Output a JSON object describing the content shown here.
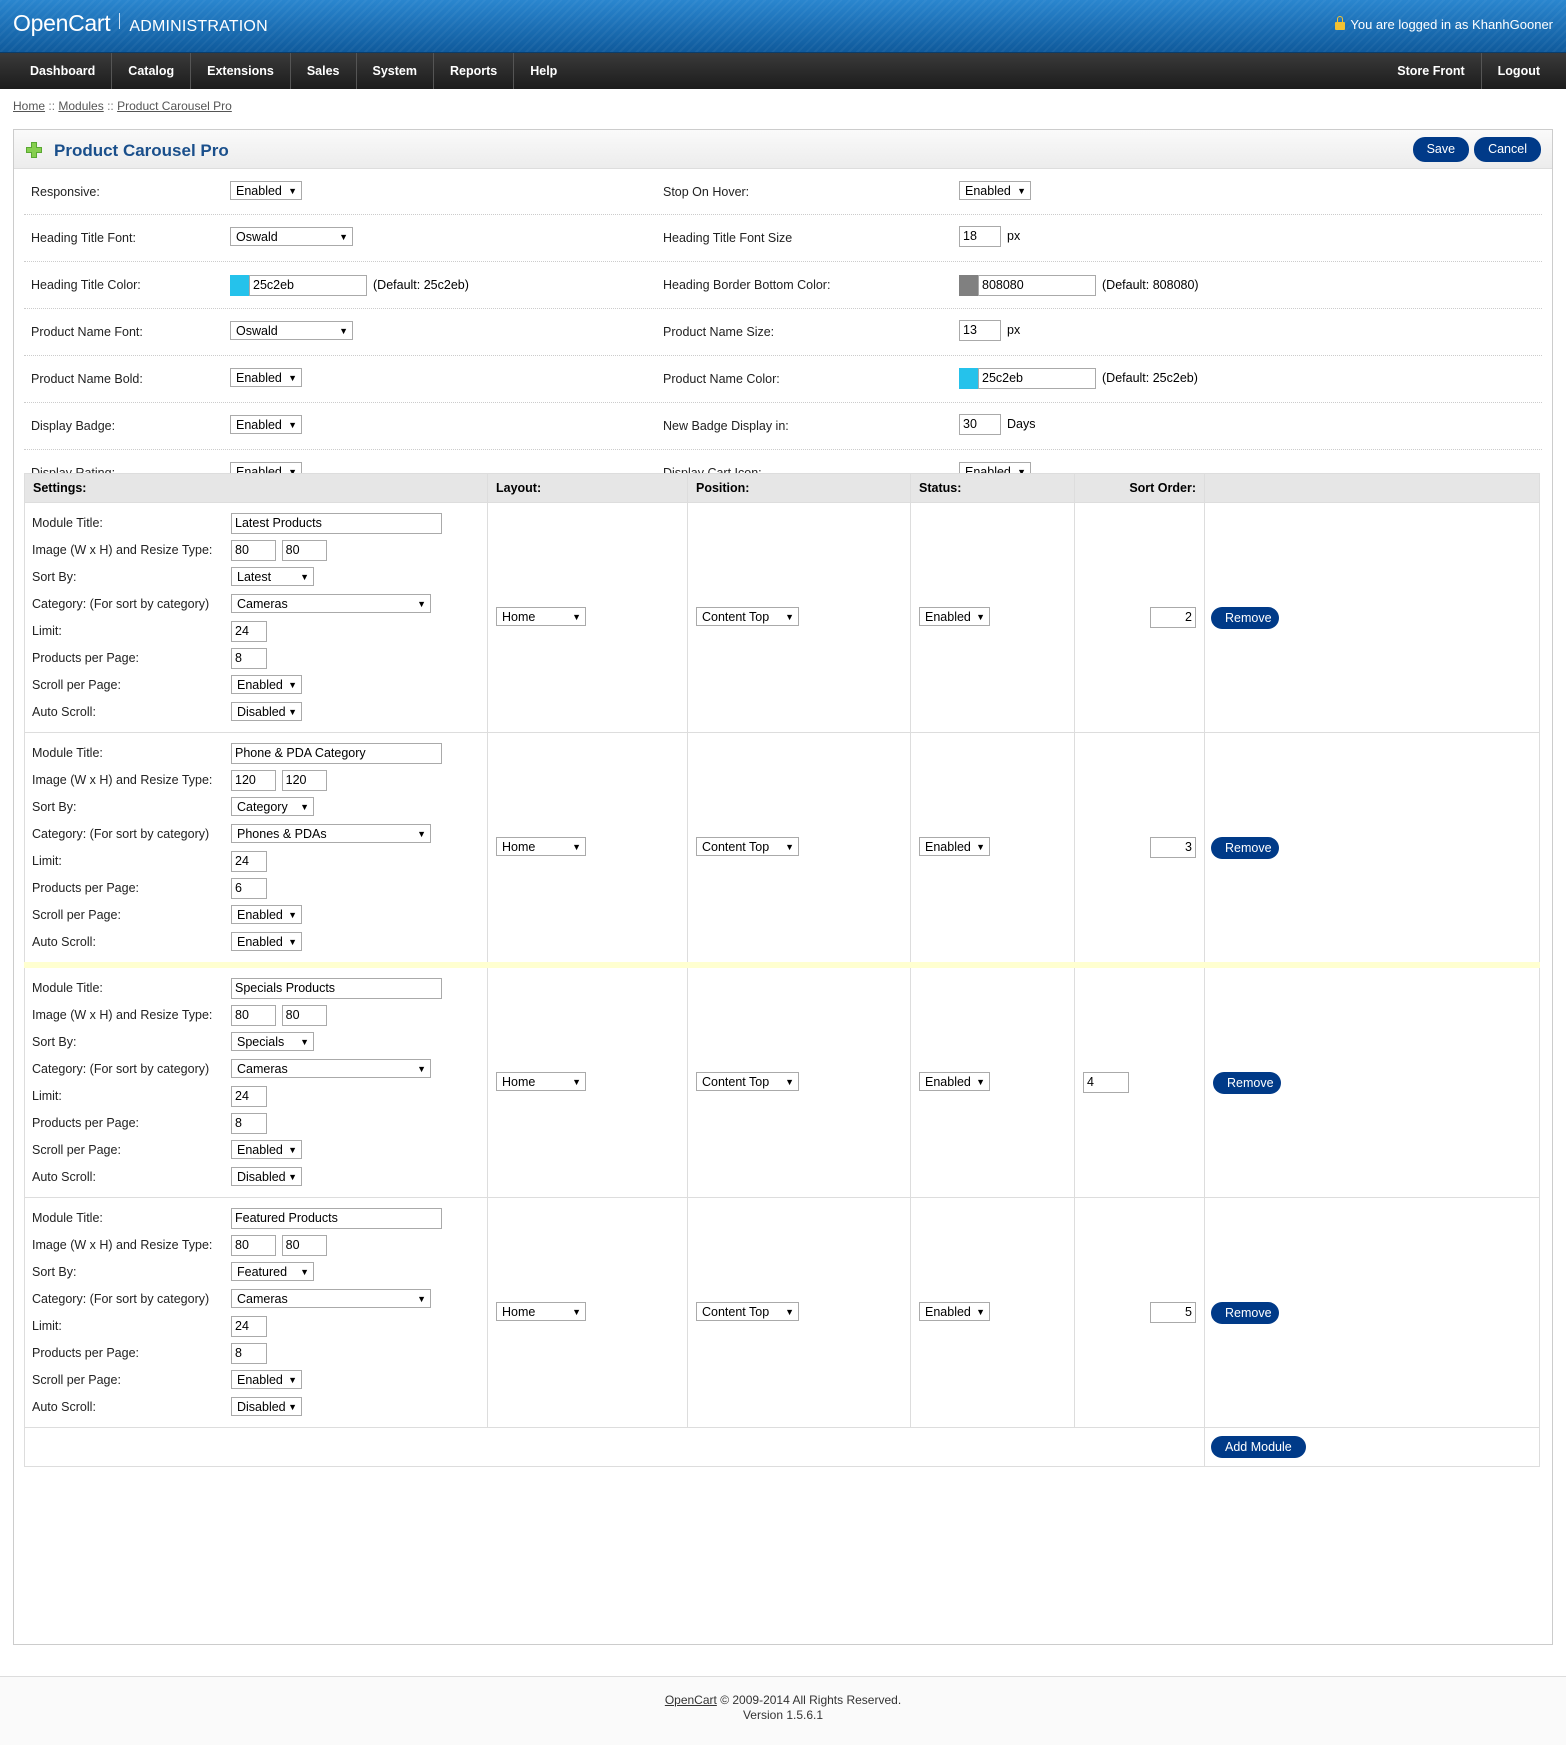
{
  "header": {
    "logo": "OpenCart",
    "subtitle": "ADMINISTRATION",
    "logged_in": "You are logged in as KhanhGooner"
  },
  "menu": {
    "left": [
      "Dashboard",
      "Catalog",
      "Extensions",
      "Sales",
      "System",
      "Reports",
      "Help"
    ],
    "right": [
      "Store Front",
      "Logout"
    ]
  },
  "breadcrumb": {
    "home": "Home",
    "modules": "Modules",
    "current": "Product Carousel Pro",
    "sep": "::"
  },
  "page": {
    "title": "Product Carousel Pro",
    "save": "Save",
    "cancel": "Cancel"
  },
  "settings": {
    "responsive": {
      "label": "Responsive:",
      "value": "Enabled"
    },
    "stop_on_hover": {
      "label": "Stop On Hover:",
      "value": "Enabled"
    },
    "heading_font": {
      "label": "Heading Title Font:",
      "value": "Oswald"
    },
    "heading_font_size": {
      "label": "Heading Title Font Size",
      "value": "18",
      "unit": "px"
    },
    "heading_color": {
      "label": "Heading Title Color:",
      "value": "25c2eb",
      "swatch": "#25c2eb",
      "default": "(Default: 25c2eb)"
    },
    "heading_border_color": {
      "label": "Heading Border Bottom Color:",
      "value": "808080",
      "swatch": "#808080",
      "default": "(Default: 808080)"
    },
    "product_name_font": {
      "label": "Product Name Font:",
      "value": "Oswald"
    },
    "product_name_size": {
      "label": "Product Name Size:",
      "value": "13",
      "unit": "px"
    },
    "product_name_bold": {
      "label": "Product Name Bold:",
      "value": "Enabled"
    },
    "product_name_color": {
      "label": "Product Name Color:",
      "value": "25c2eb",
      "swatch": "#25c2eb",
      "default": "(Default: 25c2eb)"
    },
    "display_badge": {
      "label": "Display Badge:",
      "value": "Enabled"
    },
    "new_badge": {
      "label": "New Badge Display in:",
      "value": "30",
      "unit": "Days"
    },
    "display_rating": {
      "label": "Display Rating:",
      "value": "Enabled"
    },
    "display_cart_icon": {
      "label": "Display Cart Icon:",
      "value": "Enabled"
    }
  },
  "table": {
    "headers": {
      "settings": "Settings:",
      "layout": "Layout:",
      "position": "Position:",
      "status": "Status:",
      "sort_order": "Sort Order:"
    },
    "labels": {
      "title": "Module Title:",
      "image": "Image (W x H) and Resize Type:",
      "sort_by": "Sort By:",
      "category": "Category: (For sort by category)",
      "limit": "Limit:",
      "per_page": "Products per Page:",
      "scroll": "Scroll per Page:",
      "auto": "Auto Scroll:"
    },
    "remove_label": "Remove",
    "add_label": "Add Module"
  },
  "modules": [
    {
      "title": "Latest Products",
      "w": "80",
      "h": "80",
      "sort_by": "Latest",
      "category": "Cameras",
      "limit": "24",
      "per_page": "8",
      "scroll": "Enabled",
      "auto": "Disabled",
      "layout": "Home",
      "position": "Content Top",
      "status": "Enabled",
      "sort_order": "2"
    },
    {
      "title": "Phone & PDA Category",
      "w": "120",
      "h": "120",
      "sort_by": "Category",
      "category": "Phones & PDAs",
      "limit": "24",
      "per_page": "6",
      "scroll": "Enabled",
      "auto": "Enabled",
      "layout": "Home",
      "position": "Content Top",
      "status": "Enabled",
      "sort_order": "3"
    },
    {
      "title": "Specials Products",
      "w": "80",
      "h": "80",
      "sort_by": "Specials",
      "category": "Cameras",
      "limit": "24",
      "per_page": "8",
      "scroll": "Enabled",
      "auto": "Disabled",
      "layout": "Home",
      "position": "Content Top",
      "status": "Enabled",
      "sort_order": "4"
    },
    {
      "title": "Featured Products",
      "w": "80",
      "h": "80",
      "sort_by": "Featured",
      "category": "Cameras",
      "limit": "24",
      "per_page": "8",
      "scroll": "Enabled",
      "auto": "Disabled",
      "layout": "Home",
      "position": "Content Top",
      "status": "Enabled",
      "sort_order": "5"
    }
  ],
  "footer": {
    "link": "OpenCart",
    "copyright": "© 2009-2014 All Rights Reserved.",
    "version": "Version 1.5.6.1"
  },
  "colors": {
    "header_blue": "#1a6fb5",
    "button_blue": "#003a88",
    "title_blue": "#1a4f8b"
  }
}
